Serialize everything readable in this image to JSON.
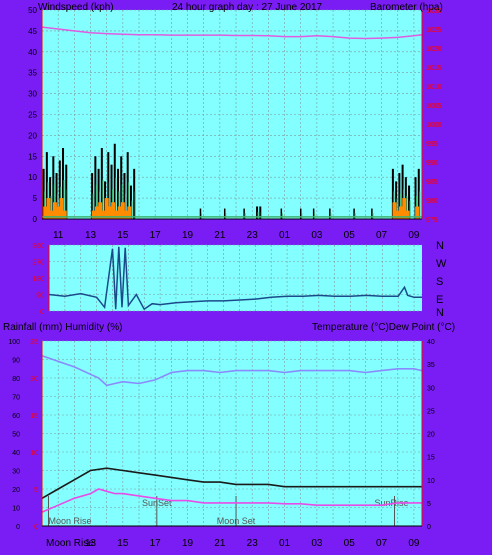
{
  "header": {
    "left_label": "Windspeed (kph)",
    "title": "24 hour graph day : 27 June 2017",
    "right_label": "Barometer (hpa)"
  },
  "bottom_header": {
    "left_label": "Rainfall (mm)  Humidity (%)",
    "right_label": "Temperature (°C)Dew Point (°C)"
  },
  "time_axis": {
    "labels": [
      "11",
      "13",
      "15",
      "17",
      "19",
      "21",
      "23",
      "01",
      "03",
      "05",
      "07",
      "09"
    ],
    "bottom_first_label": "Moon Rise"
  },
  "direction_labels": [
    "N",
    "W",
    "S",
    "E",
    "N"
  ],
  "sun_moon_labels": [
    {
      "text": "Moon Rise",
      "hour": 10.4,
      "row": 1
    },
    {
      "text": "SunSet",
      "hour": 17.1,
      "row": 1
    },
    {
      "text": "Moon Set",
      "hour": 22.0,
      "row": 1
    },
    {
      "text": "SunRise",
      "hour": 31.8,
      "row": 1
    }
  ],
  "colors": {
    "frame": "#7a1cf4",
    "plot_bg": "#84ffff",
    "grid": "#7a9a9a",
    "axis_red": "#ff0000",
    "barometer": "#e05ce0",
    "wind_avg": "#ff8c00",
    "wind_gust": "#000000",
    "wind_green": "#3cb371",
    "direction": "#1a4a8a",
    "humidity": "#8a8aff",
    "temperature": "#1a1a1a",
    "dewpoint": "#e84ce8",
    "markers": "#555555"
  },
  "chart_data": [
    {
      "type": "line",
      "name": "wind-barometer",
      "x_unit": "hour",
      "xlim": [
        10,
        33.5
      ],
      "ylim": [
        0,
        50
      ],
      "ylim_right": [
        975,
        1030
      ],
      "left_ticks": [
        0,
        5,
        10,
        15,
        20,
        25,
        30,
        35,
        40,
        45,
        50
      ],
      "right_ticks": [
        975,
        980,
        985,
        990,
        995,
        1000,
        1005,
        1010,
        1015,
        1020,
        1025,
        1030
      ],
      "series": [
        {
          "axis": "right",
          "x": [
            10,
            11,
            12,
            13,
            14,
            15,
            16,
            17,
            18,
            19,
            20,
            21,
            22,
            23,
            24,
            25,
            26,
            27,
            28,
            29,
            30,
            31,
            32,
            33,
            33.5
          ],
          "values": [
            1025.5,
            1025,
            1024.5,
            1024,
            1023.8,
            1023.6,
            1023.5,
            1023.5,
            1023.4,
            1023.4,
            1023.4,
            1023.4,
            1023.3,
            1023.3,
            1023.2,
            1023.0,
            1023.0,
            1023.2,
            1023.0,
            1022.6,
            1022.5,
            1022.6,
            1022.8,
            1023.2,
            1023.5
          ]
        },
        {
          "axis": "left",
          "style": "gust-bars",
          "x": [
            10.1,
            10.3,
            10.5,
            10.7,
            10.9,
            11.1,
            11.3,
            11.5,
            13.1,
            13.3,
            13.5,
            13.7,
            13.9,
            14.1,
            14.3,
            14.5,
            14.7,
            14.9,
            15.1,
            15.3,
            15.5,
            15.7,
            23.3,
            23.5,
            31.7,
            31.9,
            32.1,
            32.3,
            32.5,
            32.7,
            33.1,
            33.3
          ],
          "values": [
            12,
            16,
            10,
            15,
            11,
            14,
            17,
            13,
            11,
            15,
            12,
            17,
            9,
            16,
            13,
            18,
            12,
            15,
            11,
            16,
            8,
            12,
            3,
            3,
            12,
            9,
            11,
            13,
            10,
            8,
            10,
            12
          ]
        },
        {
          "axis": "left",
          "style": "gust-bars-small",
          "x": [
            19.8,
            21.3,
            22.5,
            24.8,
            26.0,
            26.8,
            27.8,
            29.3,
            30.4
          ],
          "values": [
            2.5,
            2.5,
            2.5,
            2.5,
            2.5,
            2.5,
            2.5,
            2.5,
            2.5
          ]
        },
        {
          "axis": "left",
          "style": "avg-bars",
          "x": [
            10.2,
            10.4,
            10.6,
            10.8,
            11.0,
            11.2,
            11.4,
            13.2,
            13.4,
            13.6,
            13.8,
            14.0,
            14.2,
            14.4,
            14.6,
            14.8,
            15.0,
            15.2,
            15.4,
            31.8,
            32.0,
            32.2,
            32.4,
            32.6,
            33.2
          ],
          "values": [
            3,
            5,
            2,
            4,
            3,
            5,
            2,
            2,
            3,
            4,
            2,
            5,
            3,
            4,
            2,
            3,
            4,
            2,
            3,
            4,
            2,
            3,
            5,
            2,
            3
          ]
        }
      ]
    },
    {
      "type": "line",
      "name": "wind-direction",
      "x_unit": "hour",
      "xlim": [
        10,
        33.5
      ],
      "ylim": [
        0,
        360
      ],
      "left_ticks": [
        0,
        90,
        180,
        270,
        360
      ],
      "series": [
        {
          "x": [
            10,
            11,
            12,
            13,
            13.5,
            14,
            14.2,
            14.4,
            14.6,
            14.8,
            15,
            15.5,
            16,
            16.5,
            17,
            18,
            19,
            20,
            21,
            22,
            23,
            24,
            25,
            26,
            27,
            28,
            29,
            30,
            31,
            32,
            32.4,
            32.6,
            33,
            33.5
          ],
          "values": [
            90,
            80,
            95,
            75,
            20,
            340,
            10,
            350,
            20,
            345,
            30,
            90,
            10,
            40,
            35,
            45,
            50,
            55,
            55,
            60,
            65,
            75,
            80,
            80,
            85,
            80,
            80,
            85,
            80,
            80,
            130,
            85,
            75,
            75
          ]
        }
      ]
    },
    {
      "type": "line",
      "name": "temperature-humidity",
      "x_unit": "hour",
      "xlim": [
        10,
        33.5
      ],
      "ylim": [
        0,
        100
      ],
      "ylim_right": [
        0,
        40
      ],
      "rain_ylim": [
        0,
        25
      ],
      "left_ticks": [
        0,
        10,
        20,
        30,
        40,
        50,
        60,
        70,
        80,
        90,
        100
      ],
      "right_ticks": [
        0,
        5,
        10,
        15,
        20,
        25,
        30,
        35,
        40
      ],
      "rain_ticks": [
        0,
        5,
        10,
        15,
        20,
        25
      ],
      "series": [
        {
          "name": "Humidity",
          "axis": "left",
          "x": [
            10,
            11,
            12,
            13,
            13.5,
            14,
            14.5,
            15,
            16,
            17,
            18,
            19,
            20,
            21,
            22,
            23,
            24,
            25,
            26,
            27,
            28,
            29,
            30,
            31,
            32,
            33,
            33.5
          ],
          "values": [
            92,
            89,
            86,
            82,
            80,
            76,
            77,
            78,
            77,
            79,
            83,
            84,
            84,
            83,
            84,
            84,
            84,
            83,
            84,
            84,
            84,
            84,
            83,
            84,
            85,
            85,
            84
          ]
        },
        {
          "name": "Temperature",
          "axis": "right",
          "x": [
            10,
            11,
            12,
            13,
            14,
            15,
            16,
            17,
            18,
            19,
            20,
            21,
            22,
            23,
            24,
            25,
            26,
            27,
            28,
            29,
            30,
            31,
            32,
            33,
            33.5
          ],
          "values": [
            6,
            8,
            10,
            12,
            12.5,
            12,
            11.5,
            11,
            10.5,
            10,
            9.5,
            9.5,
            9,
            9,
            9,
            8.5,
            8.5,
            8.5,
            8.5,
            8.5,
            8.5,
            8.5,
            8.5,
            8.5,
            8.5
          ]
        },
        {
          "name": "Dew Point",
          "axis": "right",
          "x": [
            10,
            11,
            12,
            13,
            13.5,
            14,
            14.5,
            15,
            16,
            17,
            18,
            19,
            20,
            21,
            22,
            23,
            24,
            25,
            26,
            27,
            28,
            29,
            30,
            31,
            32,
            33,
            33.5
          ],
          "values": [
            3,
            4.5,
            6,
            7,
            8,
            7.5,
            7,
            7,
            6.5,
            6,
            5.5,
            5.5,
            5,
            5,
            5,
            5,
            5,
            4.8,
            4.8,
            4.5,
            4.5,
            4.5,
            4.5,
            4.5,
            5,
            5,
            5
          ]
        }
      ]
    }
  ]
}
